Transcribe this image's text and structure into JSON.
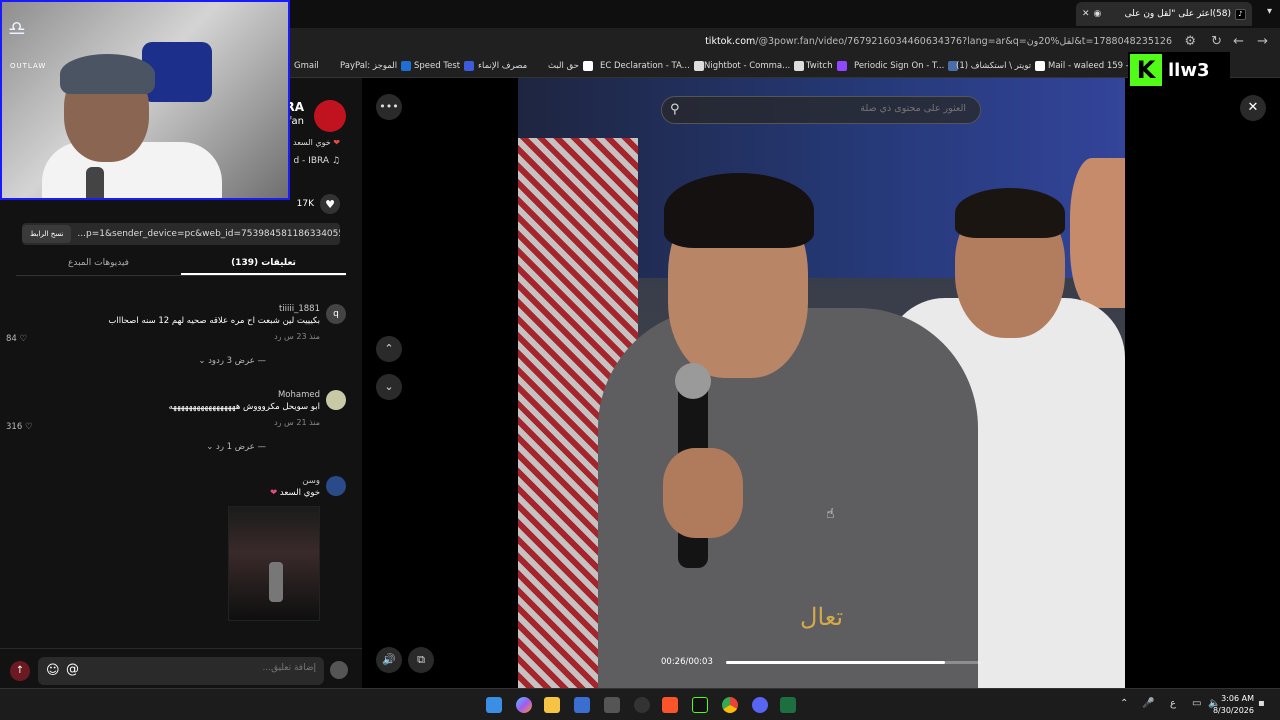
{
  "browser": {
    "tab_title": "(58)اعثر على \"لقل ون على",
    "url_domain": "tiktok.com",
    "url_path": "/@3powr.fan/video/7679216034460634376?lang=ar&q=لقل%20ون&t=1788048235126"
  },
  "bookmarks": [
    {
      "label": "Gmail",
      "color": "#ea4335"
    },
    {
      "label": "PayPal: الموجز",
      "color": "#1f6fd1"
    },
    {
      "label": "Speed Test",
      "color": "#3b5bdb"
    },
    {
      "label": "مصرف الإنماء",
      "color": "#666666"
    },
    {
      "label": "حق البث",
      "color": "#ffffff"
    },
    {
      "label": "EC Declaration - TA...",
      "color": "#dddddd"
    },
    {
      "label": "Nightbot - Comma...",
      "color": "#dddddd"
    },
    {
      "label": "Twitch",
      "color": "#9146ff"
    },
    {
      "label": "Periodic Sign On - T...",
      "color": "#4a6da7"
    },
    {
      "label": "(1) تويتر \\ استكشاف",
      "color": "#ffffff"
    },
    {
      "label": "Mail - waleed 159 -...",
      "color": "#0078d4"
    }
  ],
  "webcam": {
    "logo_text": "OUTLAW"
  },
  "kick": {
    "name": "llw3"
  },
  "creator": {
    "name": "IBRA",
    "handle": "fan",
    "description": "خوي السعد",
    "music": "d - IBRA",
    "likes": "17K"
  },
  "share": {
    "copy_label": "نسخ الرابط",
    "link": "...p=1&sender_device=pc&web_id=7539845811863340551"
  },
  "tabs": {
    "comments": "(139) تعليقات",
    "creator_videos": "فيديوهات المبدع"
  },
  "comments": [
    {
      "user": "tiiiii_1881",
      "avatar": "q",
      "text": "بكيييت لين شبعت اح مره علاقه صحيه لهم 12 سنه اصحاااب",
      "meta": "منذ 23 س   رد",
      "likes": "84",
      "replies": "عرض 3 ردود"
    },
    {
      "user": "Mohamed",
      "avatar": "",
      "text": "ابو سويحل مكروووش هههههههههههههههههه",
      "meta": "منذ 21 س   رد",
      "likes": "316",
      "replies": "عرض 1 رد"
    },
    {
      "user": "وسن",
      "avatar": "",
      "text": "خوي السعد",
      "meta": "",
      "likes": "",
      "replies": ""
    }
  ],
  "input": {
    "placeholder": "إضافة تعليق..."
  },
  "video": {
    "search_placeholder": "العثور على محتوى ذي صلة",
    "caption": "تعال",
    "time": "00:26/00:03",
    "progress": 0.86
  },
  "taskbar": {
    "time": "3:06 AM",
    "date": "8/30/2026",
    "lang": "ع"
  }
}
